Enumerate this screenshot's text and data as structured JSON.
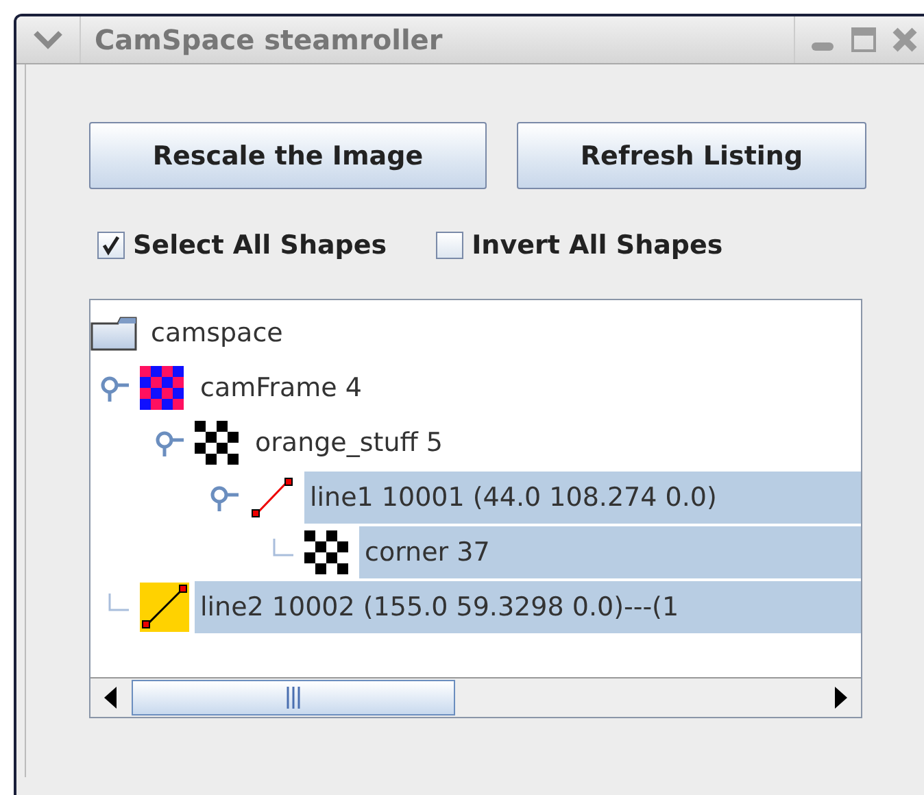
{
  "window": {
    "title": "CamSpace steamroller"
  },
  "buttons": [
    {
      "label": "Rescale the Image"
    },
    {
      "label": "Refresh Listing"
    }
  ],
  "checkboxes": [
    {
      "label": "Select All Shapes",
      "checked": true
    },
    {
      "label": "Invert All Shapes",
      "checked": false
    }
  ],
  "tree": {
    "root": {
      "label": "camspace",
      "kind": "folder",
      "selected": false,
      "children": [
        {
          "label": "camFrame 4",
          "kind": "color-grid",
          "selected": false,
          "expanded": true,
          "children": [
            {
              "label": "orange_stuff 5",
              "kind": "grid",
              "selected": false,
              "expanded": true,
              "children": [
                {
                  "label": "line1 10001 (44.0 108.274 0.0)",
                  "kind": "line",
                  "selected": true,
                  "expanded": true,
                  "children": [
                    {
                      "label": "corner 37",
                      "kind": "grid",
                      "selected": true
                    }
                  ]
                }
              ]
            }
          ]
        },
        {
          "label": "line2 10002 (155.0 59.3298 0.0)---(1",
          "kind": "line-filled",
          "selected": true
        }
      ]
    }
  }
}
